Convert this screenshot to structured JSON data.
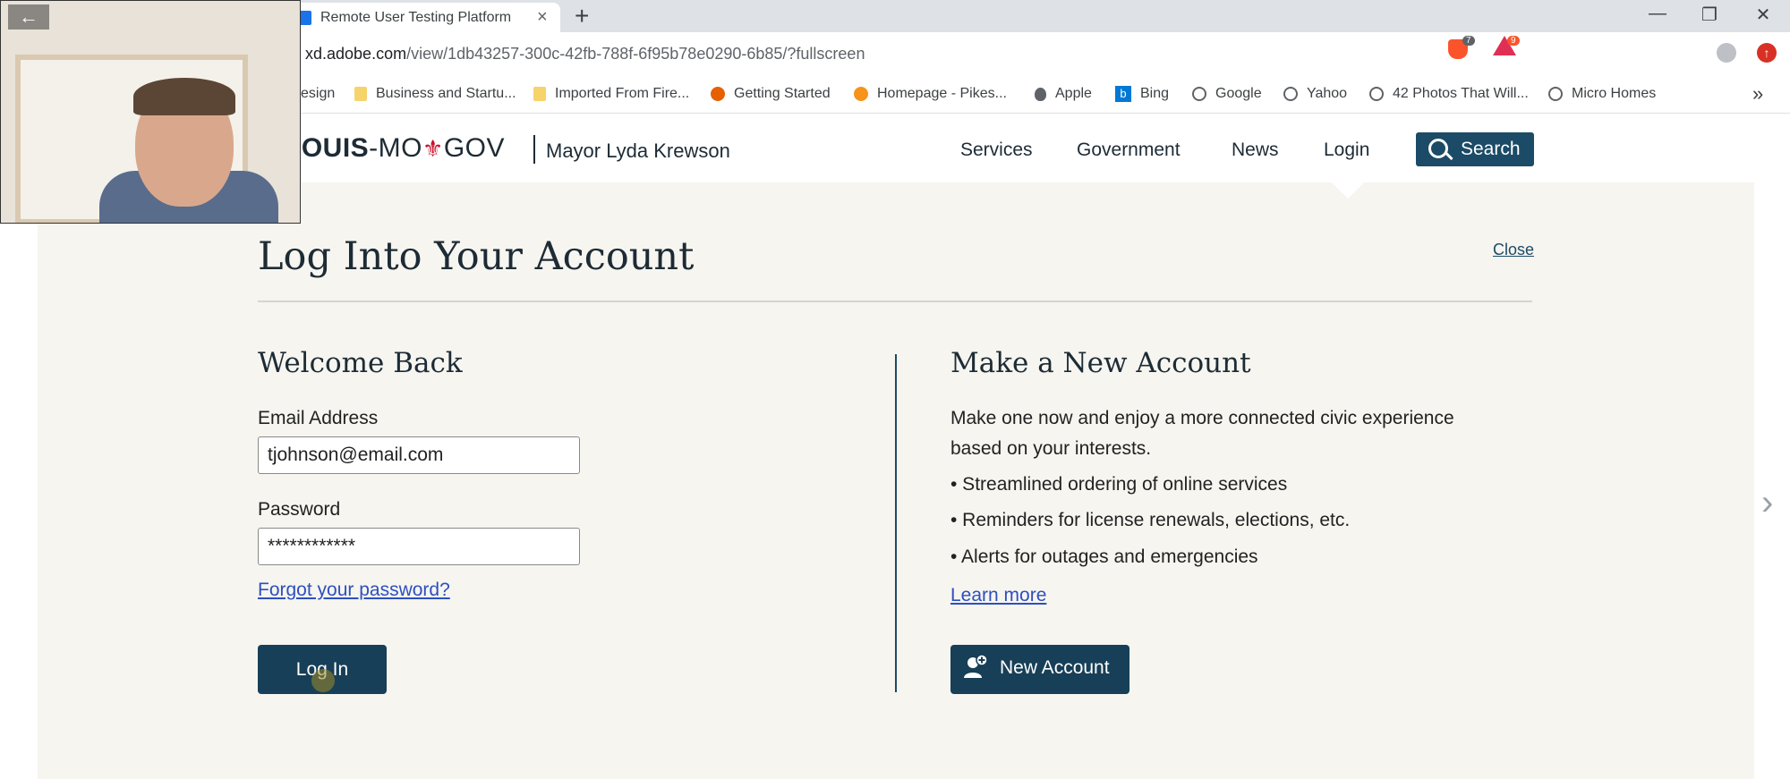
{
  "browser": {
    "tab_title": "Remote User Testing Platform | Us",
    "url_host": "xd.adobe.com",
    "url_path": "/view/1db43257-300c-42fb-788f-6f95b78e0290-6b85/?fullscreen",
    "brave_shields_count": "7",
    "rewards_count": "9",
    "bookmarks": [
      {
        "label": "esign",
        "icon": "none"
      },
      {
        "label": "Business and Startu...",
        "icon": "folder-icon"
      },
      {
        "label": "Imported From Fire...",
        "icon": "folder-icon"
      },
      {
        "label": "Getting Started",
        "icon": "firefox-icon"
      },
      {
        "label": "Homepage - Pikes...",
        "icon": "bitcoin-icon"
      },
      {
        "label": "Apple",
        "icon": "apple-icon"
      },
      {
        "label": "Bing",
        "icon": "bing-icon"
      },
      {
        "label": "Google",
        "icon": "globe-icon"
      },
      {
        "label": "Yahoo",
        "icon": "globe-icon"
      },
      {
        "label": "42 Photos That Will...",
        "icon": "globe-icon"
      },
      {
        "label": "Micro Homes",
        "icon": "globe-icon"
      }
    ]
  },
  "site": {
    "logo_left": "LOUIS",
    "logo_mid": "-MO",
    "logo_fleur": "⚜",
    "logo_right": "GOV",
    "mayor": "Mayor Lyda Krewson",
    "nav": [
      "Services",
      "Government",
      "News",
      "Login"
    ],
    "search_label": "Search"
  },
  "login_panel": {
    "title": "Log Into Your Account",
    "close_label": "Close",
    "welcome_heading": "Welcome Back",
    "email_label": "Email Address",
    "email_value": "tjohnson@email.com",
    "password_label": "Password",
    "password_value": "************",
    "forgot_label": "Forgot your password?",
    "login_button": "Log In",
    "new_heading": "Make a New Account",
    "new_intro_line1": "Make one now and enjoy a more connected civic experience",
    "new_intro_line2": "based on your interests.",
    "benefits": [
      "• Streamlined ordering of online services",
      "• Reminders for license renewals, elections, etc.",
      "• Alerts for outages and emergencies"
    ],
    "learn_more": "Learn more",
    "new_account_button": "New Account"
  },
  "colors": {
    "panel_bg": "#f6f5f0",
    "primary_dark": "#173f57",
    "link": "#2e4fbf",
    "fleur_red": "#c8102e"
  }
}
